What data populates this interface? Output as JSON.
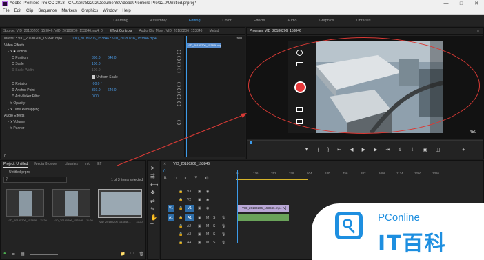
{
  "window": {
    "title": "Adobe Premiere Pro CC 2018 - C:\\Users\\82202\\Documents\\Adobe\\Premiere Pro\\12.0\\Untitled.prproj *",
    "min": "—",
    "max": "□",
    "close": "✕"
  },
  "menu": [
    "File",
    "Edit",
    "Clip",
    "Sequence",
    "Markers",
    "Graphics",
    "Window",
    "Help"
  ],
  "workspaces": [
    "Learning",
    "Assembly",
    "Editing",
    "Color",
    "Effects",
    "Audio",
    "Graphics",
    "Libraries"
  ],
  "source_tabs": {
    "source": "Source: VID_20180206_153846: VID_20180206_153846.mp4: 0",
    "effect_controls": "Effect Controls",
    "audio_mixer": "Audio Clip Mixer: VID_20180206_153846",
    "metadata": "Metad"
  },
  "effect_controls": {
    "master": "Master * VID_20180206_153846.mp4",
    "clip": "VID_20180206_153846 * VID_20180206_153846.mp4",
    "timecode_end": "300",
    "clip_bar": "VID_20180206_153846.mp4",
    "video_effects": "Video Effects",
    "motion": "Motion",
    "position": "Position",
    "position_x": "360.0",
    "position_y": "640.0",
    "scale": "Scale",
    "scale_val": "100.0",
    "scale_width": "Scale Width",
    "scale_width_val": "100.0",
    "uniform_scale": "Uniform Scale",
    "rotation": "Rotation",
    "rotation_val": "-90.0 °",
    "anchor": "Anchor Point",
    "anchor_x": "360.0",
    "anchor_y": "640.0",
    "antiflicker": "Anti-flicker Filter",
    "antiflicker_val": "0.00",
    "opacity": "Opacity",
    "time_remap": "Time Remapping",
    "audio_effects": "Audio Effects",
    "volume": "Volume",
    "panner": "Panner",
    "bottom_tc": "0"
  },
  "program": {
    "title": "Program: VID_20180206_153846",
    "dur": "450",
    "menu": "≡"
  },
  "project_tabs": {
    "project": "Project: Untitled",
    "media_browser": "Media Browser",
    "libraries": "Libraries",
    "info": "Info",
    "fx": "Eff"
  },
  "project": {
    "file": "Untitled.prproj",
    "selected": "1 of 3 items selected",
    "items": [
      {
        "name": "VID_20180206_153846...",
        "dur": "11:20"
      },
      {
        "name": "VID_20180206_153846...",
        "dur": "11:20"
      },
      {
        "name": "VID_20180206_153846...",
        "dur": "11:20"
      }
    ]
  },
  "timeline": {
    "tab": "VID_20180206_153846",
    "timecode": "0",
    "ruler": [
      "0",
      "126",
      "252",
      "378",
      "504",
      "630",
      "756",
      "882",
      "1008",
      "1134",
      "1260",
      "1386"
    ],
    "video_tracks": [
      "V3",
      "V2",
      "V1"
    ],
    "audio_tracks": [
      "A1",
      "A2",
      "A3",
      "A4"
    ],
    "src_v": "V1",
    "src_a": "A1",
    "clip_video": "VID_20180206_153846.mp4 [V]",
    "m": "M",
    "s": "S"
  },
  "watermark": {
    "brand": "PConline",
    "cn": "IT百科"
  },
  "colors": {
    "accent": "#3d9be9",
    "record": "#e8393b",
    "annotation": "#d93a35",
    "watermark": "#1e8fe0"
  }
}
